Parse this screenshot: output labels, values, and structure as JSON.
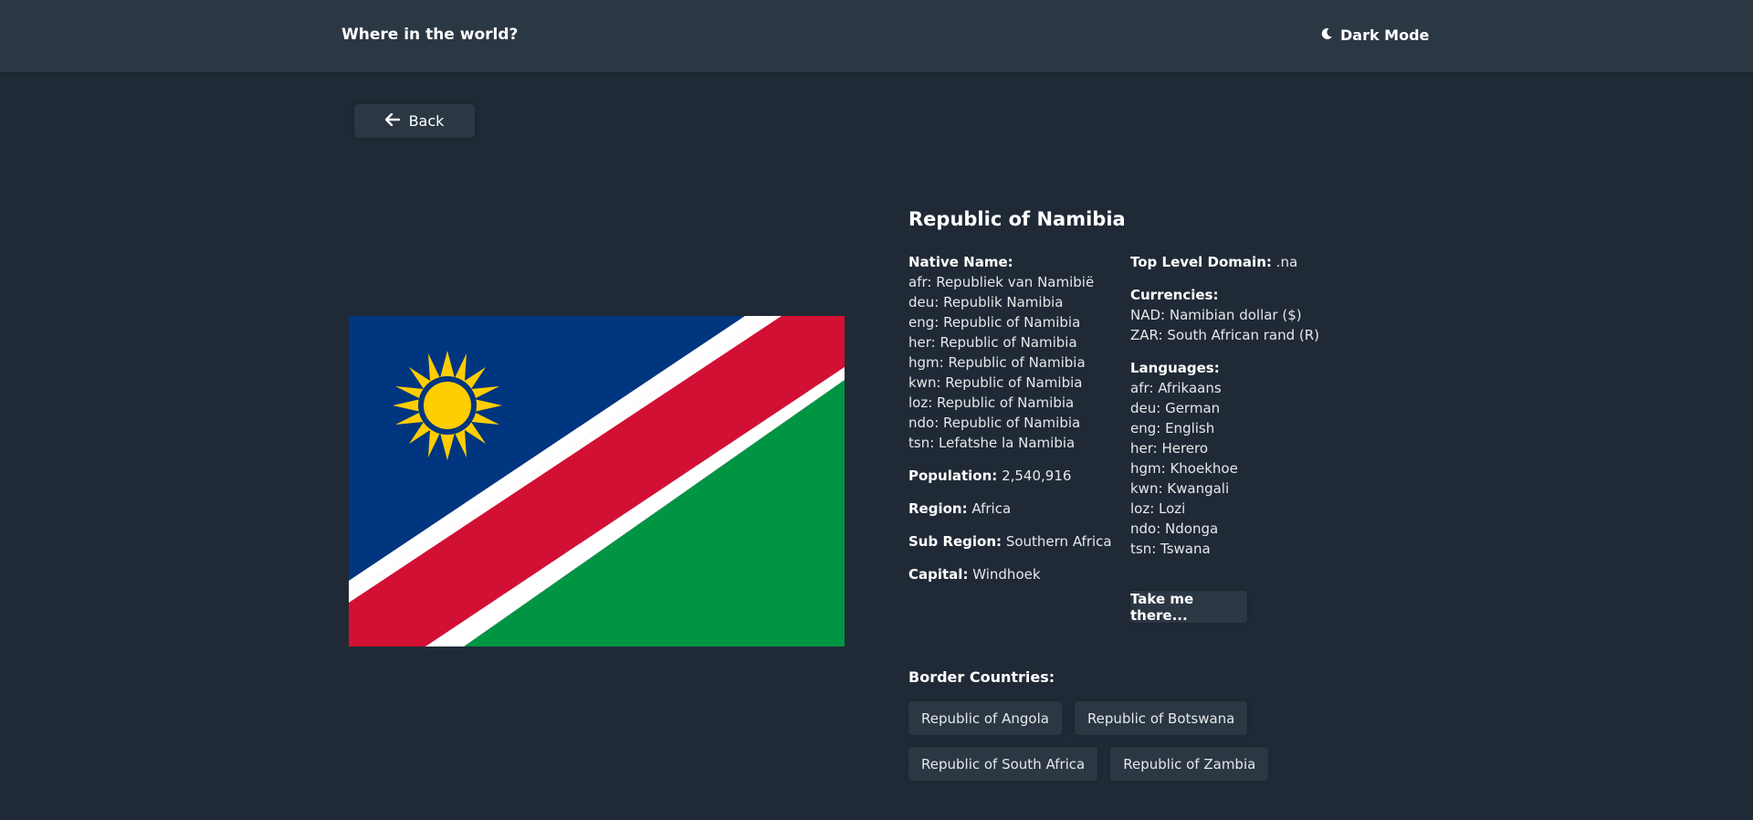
{
  "header": {
    "title": "Where in the world?",
    "theme_toggle_label": "Dark Mode",
    "theme_icon": "moon-icon"
  },
  "back_button": {
    "label": "Back",
    "icon": "arrow-left-icon"
  },
  "flag": {
    "icon": "flag-namibia",
    "colors": {
      "blue": "#003580",
      "red": "#d21034",
      "green": "#009543",
      "white": "#ffffff",
      "sun": "#ffce00"
    }
  },
  "country": {
    "name": "Republic of Namibia",
    "native_name_label": "Native Name:",
    "native_names": [
      "afr: Republiek van Namibië",
      "deu: Republik Namibia",
      "eng: Republic of Namibia",
      "her: Republic of Namibia",
      "hgm: Republic of Namibia",
      "kwn: Republic of Namibia",
      "loz: Republic of Namibia",
      "ndo: Republic of Namibia",
      "tsn: Lefatshe la Namibia"
    ],
    "population_label": "Population:",
    "population": "2,540,916",
    "region_label": "Region:",
    "region": "Africa",
    "subregion_label": "Sub Region:",
    "subregion": "Southern Africa",
    "capital_label": "Capital:",
    "capital": "Windhoek",
    "tld_label": "Top Level Domain:",
    "tld": ".na",
    "currencies_label": "Currencies:",
    "currencies": [
      "NAD: Namibian dollar ($)",
      "ZAR: South African rand (R)"
    ],
    "languages_label": "Languages:",
    "languages": [
      "afr: Afrikaans",
      "deu: German",
      "eng: English",
      "her: Herero",
      "hgm: Khoekhoe",
      "kwn: Kwangali",
      "loz: Lozi",
      "ndo: Ndonga",
      "tsn: Tswana"
    ],
    "maps_button": "Take me there..."
  },
  "borders": {
    "title": "Border Countries:",
    "countries": [
      "Republic of Angola",
      "Republic of Botswana",
      "Republic of South Africa",
      "Republic of Zambia"
    ]
  },
  "colors": {
    "background": "#202a36",
    "surface": "#2b3743",
    "text": "#ffffff"
  }
}
